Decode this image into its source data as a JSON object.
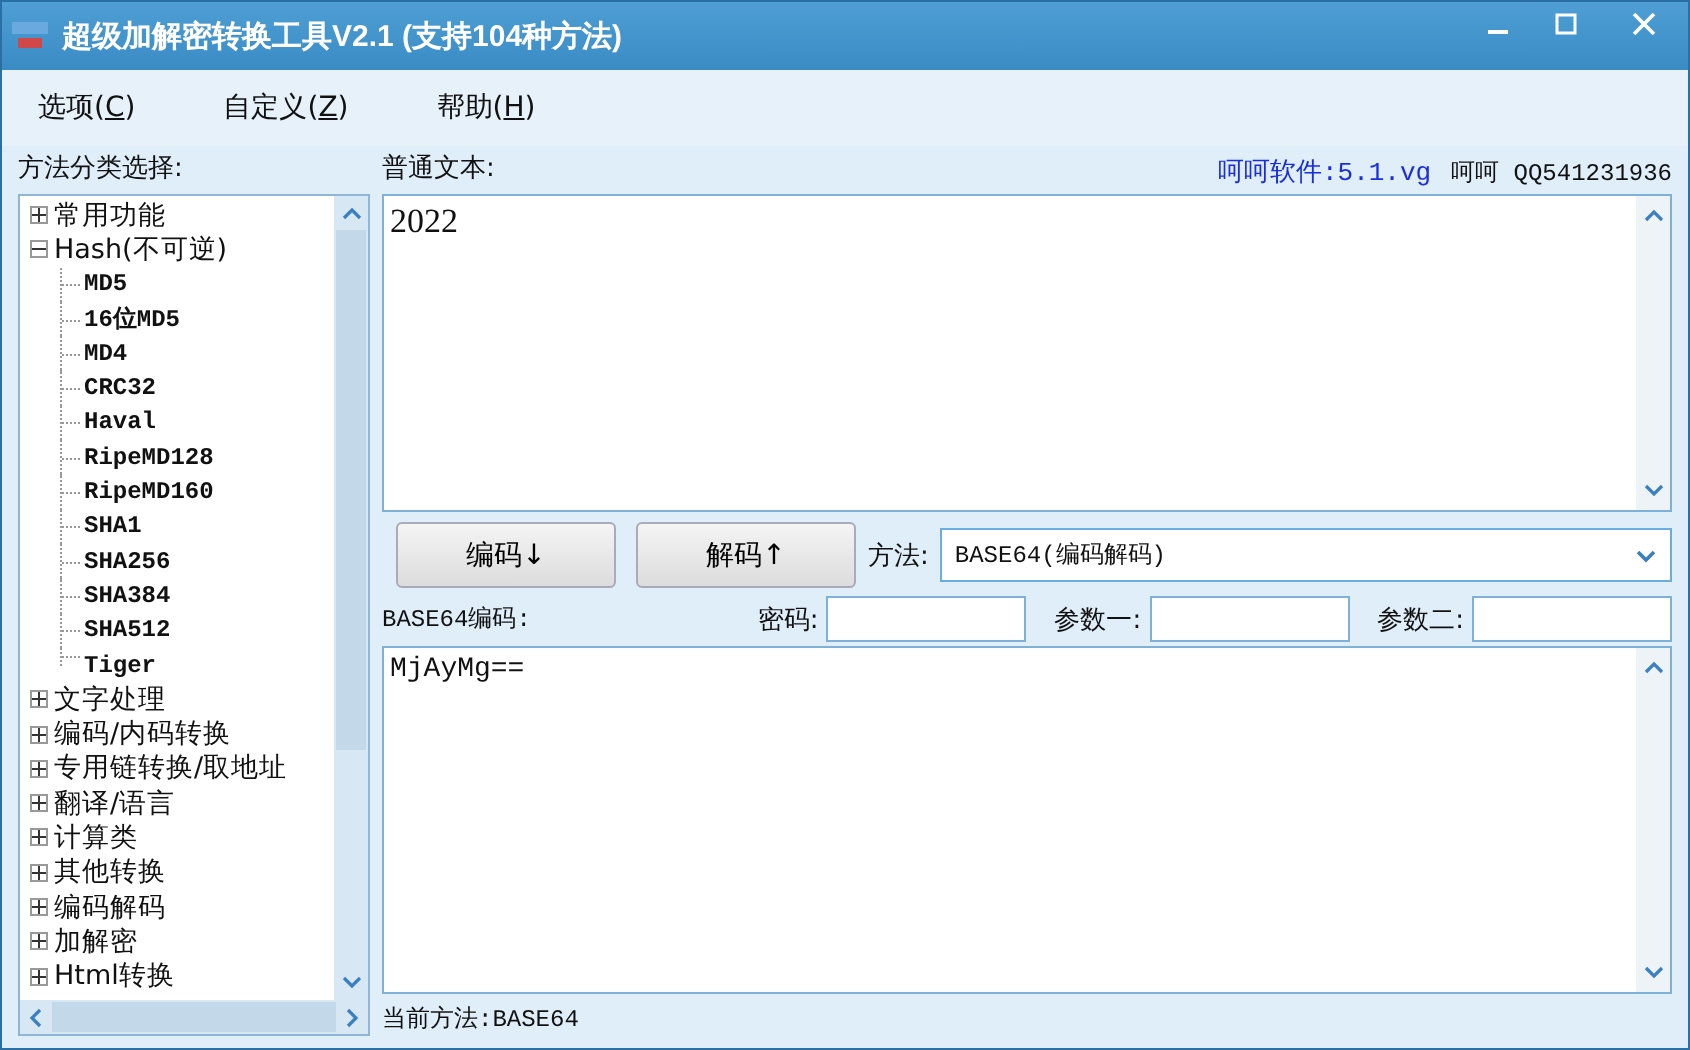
{
  "window": {
    "title": "超级加解密转换工具V2.1 (支持104种方法)"
  },
  "menu": [
    {
      "label": "选项(",
      "hotkey": "C",
      "after": ")"
    },
    {
      "label": "自定义(",
      "hotkey": "Z",
      "after": ")"
    },
    {
      "label": "帮助(",
      "hotkey": "H",
      "after": ")"
    }
  ],
  "sidebar": {
    "title": "方法分类选择:",
    "tree": [
      {
        "label": "常用功能",
        "expanded": false
      },
      {
        "label": "Hash(不可逆)",
        "expanded": true,
        "children": [
          {
            "label": "MD5"
          },
          {
            "label": "16位MD5"
          },
          {
            "label": "MD4"
          },
          {
            "label": "CRC32"
          },
          {
            "label": "Haval"
          },
          {
            "label": "RipeMD128"
          },
          {
            "label": "RipeMD160"
          },
          {
            "label": "SHA1"
          },
          {
            "label": "SHA256"
          },
          {
            "label": "SHA384"
          },
          {
            "label": "SHA512"
          },
          {
            "label": "Tiger"
          }
        ]
      },
      {
        "label": "文字处理",
        "expanded": false
      },
      {
        "label": "编码/内码转换",
        "expanded": false
      },
      {
        "label": "专用链转换/取地址",
        "expanded": false
      },
      {
        "label": "翻译/语言",
        "expanded": false
      },
      {
        "label": "计算类",
        "expanded": false
      },
      {
        "label": "其他转换",
        "expanded": false
      },
      {
        "label": "编码解码",
        "expanded": false
      },
      {
        "label": "加解密",
        "expanded": false
      },
      {
        "label": "Html转换",
        "expanded": false
      }
    ]
  },
  "input": {
    "label": "普通文本:",
    "link": "呵呵软件:5.1.vg",
    "author": "呵呵 QQ541231936",
    "value": "2022"
  },
  "buttons": [
    {
      "label": "编码↓"
    },
    {
      "label": "解码↑"
    }
  ],
  "method": {
    "label": "方法:",
    "value": "BASE64(编码解码)"
  },
  "output": {
    "label": "BASE64编码:",
    "value": "MjAyMg=="
  },
  "params": [
    {
      "label": "密码:"
    },
    {
      "label": "参数一:"
    },
    {
      "label": "参数二:"
    }
  ],
  "status_bar": {
    "text": "当前方法:BASE64"
  }
}
